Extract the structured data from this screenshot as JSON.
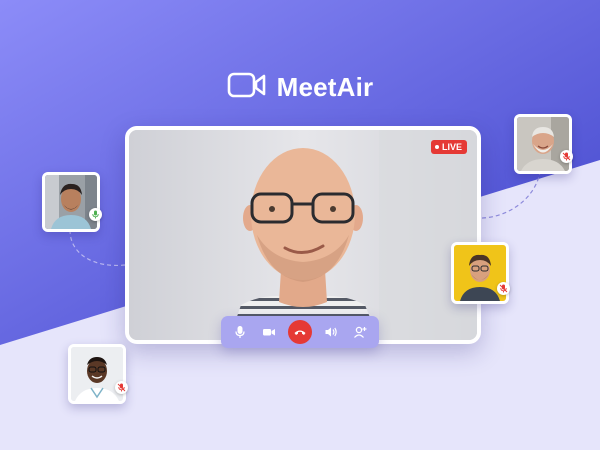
{
  "app": {
    "name": "MeetAir"
  },
  "main_call": {
    "live_label": "LIVE",
    "participant": "main-speaker"
  },
  "controls": [
    {
      "name": "microphone-button",
      "icon": "microphone-icon"
    },
    {
      "name": "camera-button",
      "icon": "video-camera-icon"
    },
    {
      "name": "end-call-button",
      "icon": "phone-hangup-icon"
    },
    {
      "name": "speaker-button",
      "icon": "speaker-volume-icon"
    },
    {
      "name": "add-participant-button",
      "icon": "add-user-icon"
    }
  ],
  "participants": [
    {
      "id": "participant-1",
      "status": "speaking",
      "status_icon": "microphone-active-icon"
    },
    {
      "id": "participant-2",
      "status": "muted",
      "status_icon": "microphone-muted-icon"
    },
    {
      "id": "participant-3",
      "status": "muted",
      "status_icon": "microphone-muted-icon"
    },
    {
      "id": "participant-4",
      "status": "muted",
      "status_icon": "microphone-muted-icon"
    }
  ],
  "colors": {
    "brand_gradient_start": "#8c8cf8",
    "brand_gradient_end": "#3f43c9",
    "lower_background": "#e6e5fb",
    "control_bar": "#a9a6f0",
    "end_call": "#e53935",
    "live_badge": "#e53935",
    "speaking_indicator": "#4caf50"
  }
}
